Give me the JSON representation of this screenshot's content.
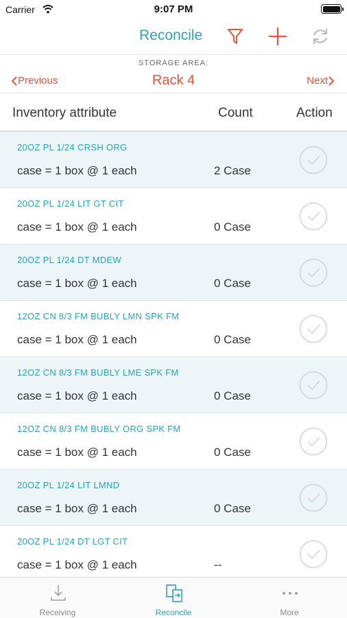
{
  "status_bar": {
    "carrier": "Carrier",
    "time": "9:07 PM"
  },
  "nav": {
    "title": "Reconcile",
    "icons": [
      "filter-icon",
      "add-icon",
      "refresh-icon"
    ]
  },
  "storage": {
    "label": "STORAGE AREA:",
    "name": "Rack 4",
    "previous_label": "Previous",
    "next_label": "Next"
  },
  "columns": {
    "attribute": "Inventory attribute",
    "count": "Count",
    "action": "Action"
  },
  "rows": [
    {
      "name": "20OZ PL 1/24 CRSH ORG",
      "unit": "case = 1 box @ 1 each",
      "count": "2 Case"
    },
    {
      "name": "20OZ PL 1/24 LIT GT CIT",
      "unit": "case = 1 box @ 1 each",
      "count": "0 Case"
    },
    {
      "name": "20OZ PL 1/24 DT MDEW",
      "unit": "case = 1 box @ 1 each",
      "count": "0 Case"
    },
    {
      "name": "12OZ CN 8/3 FM BUBLY LMN SPK FM",
      "unit": "case = 1 box @ 1 each",
      "count": "0 Case"
    },
    {
      "name": "12OZ CN 8/3 FM BUBLY LME SPK FM",
      "unit": "case = 1 box @ 1 each",
      "count": "0 Case"
    },
    {
      "name": "12OZ CN 8/3 FM BUBLY ORG SPK FM",
      "unit": "case = 1 box @ 1 each",
      "count": "0 Case"
    },
    {
      "name": "20OZ PL 1/24 LIT LMND",
      "unit": "case = 1 box @ 1 each",
      "count": "0 Case"
    },
    {
      "name": "20OZ PL 1/24 DT LGT CIT",
      "unit": "case = 1 box @ 1 each",
      "count": "--"
    }
  ],
  "tabs": {
    "receiving": "Receiving",
    "reconcile": "Reconcile",
    "more": "More",
    "active": "reconcile"
  },
  "colors": {
    "accent_teal": "#2ba3b4",
    "accent_red": "#e8533a",
    "row_alt": "#edf5f6"
  }
}
